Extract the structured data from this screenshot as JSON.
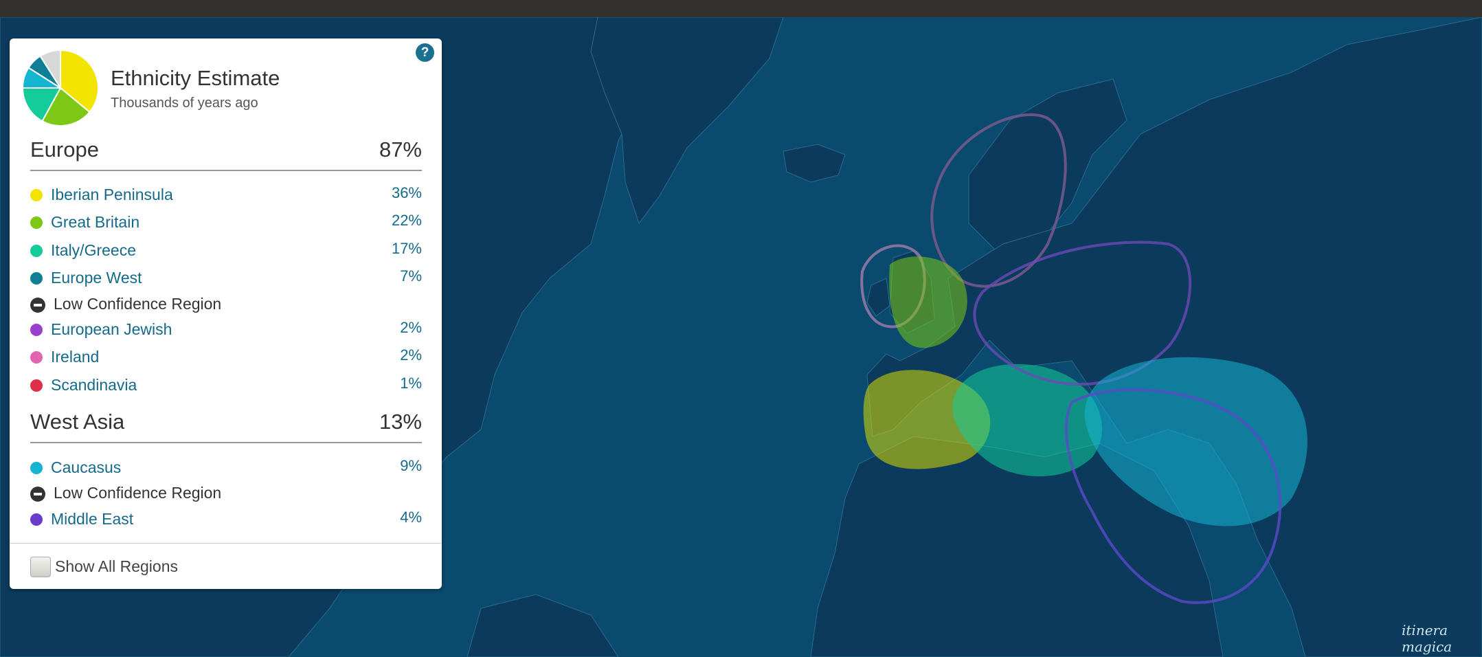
{
  "header": {
    "title": "Ethnicity Estimate",
    "subtitle": "Thousands of years ago",
    "help_label": "?"
  },
  "groups": [
    {
      "name": "Europe",
      "percent": "87%",
      "regions": [
        {
          "label": "Iberian Peninsula",
          "percent": "36%",
          "color": "#f2e300"
        },
        {
          "label": "Great Britain",
          "percent": "22%",
          "color": "#7cc814"
        },
        {
          "label": "Italy/Greece",
          "percent": "17%",
          "color": "#14cc9a"
        },
        {
          "label": "Europe West",
          "percent": "7%",
          "color": "#0e7f94"
        },
        {
          "label": "Low Confidence Region",
          "percent": "",
          "low_confidence": true
        },
        {
          "label": "European Jewish",
          "percent": "2%",
          "color": "#9a3fcc"
        },
        {
          "label": "Ireland",
          "percent": "2%",
          "color": "#e066b2"
        },
        {
          "label": "Scandinavia",
          "percent": "1%",
          "color": "#e02d48"
        }
      ]
    },
    {
      "name": "West Asia",
      "percent": "13%",
      "regions": [
        {
          "label": "Caucasus",
          "percent": "9%",
          "color": "#15b5d2"
        },
        {
          "label": "Low Confidence Region",
          "percent": "",
          "low_confidence": true
        },
        {
          "label": "Middle East",
          "percent": "4%",
          "color": "#6a3ccc"
        }
      ]
    }
  ],
  "pie": {
    "slices": [
      {
        "value": 36,
        "color": "#f2e300"
      },
      {
        "value": 22,
        "color": "#7cc814"
      },
      {
        "value": 17,
        "color": "#14cc9a"
      },
      {
        "value": 9,
        "color": "#15b5d2"
      },
      {
        "value": 7,
        "color": "#0e7f94"
      },
      {
        "value": 9,
        "color": "#d8d8d8"
      }
    ]
  },
  "footer": {
    "show_all_label": "Show All Regions",
    "checked": false
  },
  "map": {
    "ocean_color": "#0a4a6e",
    "land_color": "#0b3a5c",
    "watermark": "itinera magica"
  }
}
